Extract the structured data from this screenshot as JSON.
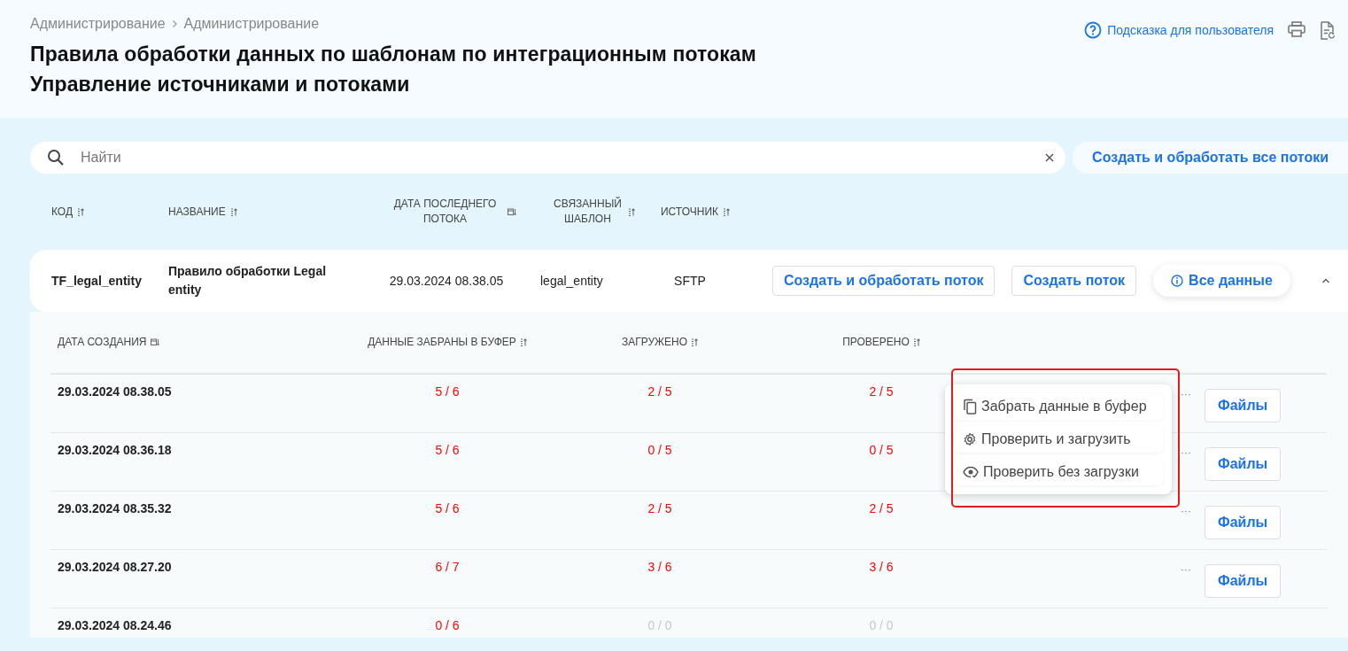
{
  "breadcrumb": [
    "Администрирование",
    "Администрирование"
  ],
  "title_lines": [
    "Правила обработки данных по шаблонам по интеграционным потокам",
    "Управление источниками и потоками"
  ],
  "help_link": "Подсказка для пользователя",
  "search": {
    "placeholder": "Найти"
  },
  "create_all_button": "Создать и обработать все потоки",
  "columns": [
    {
      "label": "КОД",
      "kind": "sort"
    },
    {
      "label": "НАЗВАНИЕ",
      "kind": "sort"
    },
    {
      "label": "ДАТА ПОСЛЕДНЕГО ПОТОКА",
      "kind": "date"
    },
    {
      "label": "СВЯЗАННЫЙ ШАБЛОН",
      "kind": "sort"
    },
    {
      "label": "ИСТОЧНИК",
      "kind": "sort"
    }
  ],
  "stream": {
    "code": "TF_legal_entity",
    "name": "Правило обработки Legal entity",
    "last_date": "29.03.2024 08.38.05",
    "template": "legal_entity",
    "source": "SFTP",
    "buttons": [
      "Создать и обработать поток",
      "Создать поток"
    ],
    "all_data_button": "Все данные",
    "expanded": true
  },
  "sub_columns": [
    {
      "label": "ДАТА СОЗДАНИЯ",
      "kind": "date"
    },
    {
      "label": "ДАННЫЕ ЗАБРАНЫ В БУФЕР",
      "kind": "sort"
    },
    {
      "label": "ЗАГРУЖЕНО",
      "kind": "sort"
    },
    {
      "label": "ПРОВЕРЕНО",
      "kind": "sort"
    }
  ],
  "runs": [
    {
      "date": "29.03.2024 08.38.05",
      "cells": [
        {
          "text": "5 / 6",
          "color": "#ff0000"
        },
        {
          "text": "2 / 5",
          "color": "#ff0000"
        },
        {
          "text": "2 / 5",
          "color": "#ff0000"
        }
      ],
      "more": "···",
      "files_button": "Файлы"
    },
    {
      "date": "29.03.2024 08.36.18",
      "cells": [
        {
          "text": "5 / 6",
          "color": "#ff0000"
        },
        {
          "text": "0 / 5",
          "color": "#ff0000"
        },
        {
          "text": "0 / 5",
          "color": "#ff0000"
        }
      ],
      "more": "···",
      "files_button": "Файлы"
    },
    {
      "date": "29.03.2024 08.35.32",
      "cells": [
        {
          "text": "5 / 6",
          "color": "#ff0000"
        },
        {
          "text": "2 / 5",
          "color": "#ff0000"
        },
        {
          "text": "2 / 5",
          "color": "#ff0000"
        }
      ],
      "more": "···",
      "files_button": "Файлы"
    },
    {
      "date": "29.03.2024 08.27.20",
      "cells": [
        {
          "text": "6 / 7",
          "color": "#ff0000"
        },
        {
          "text": "3 / 6",
          "color": "#ff0000"
        },
        {
          "text": "3 / 6",
          "color": "#ff0000"
        }
      ],
      "more": "···",
      "files_button": "Файлы"
    },
    {
      "date": "29.03.2024 08.24.46",
      "cells": [
        {
          "text": "0 / 6",
          "color": "#ff0000"
        },
        {
          "text": "0 / 0",
          "color": "#c8c8c8"
        },
        {
          "text": "0 / 0",
          "color": "#c8c8c8"
        }
      ]
    }
  ],
  "context_menu": {
    "items": [
      {
        "label": "Забрать данные в буфер",
        "kind": "copy"
      },
      {
        "label": "Проверить и загрузить",
        "kind": "gear"
      },
      {
        "label": "Проверить без загрузки",
        "kind": "eye"
      }
    ]
  }
}
